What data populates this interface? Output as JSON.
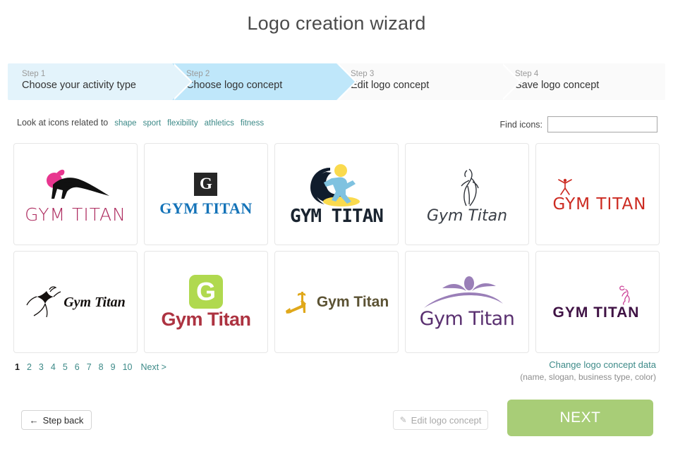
{
  "header": {
    "title": "Logo creation wizard"
  },
  "stepper": {
    "steps": [
      {
        "num": "Step 1",
        "label": "Choose your activity type",
        "state": "done"
      },
      {
        "num": "Step 2",
        "label": "Choose logo concept",
        "state": "active"
      },
      {
        "num": "Step 3",
        "label": "Edit logo concept",
        "state": "pending"
      },
      {
        "num": "Step 4",
        "label": "Save logo concept",
        "state": "pending"
      }
    ]
  },
  "filters": {
    "prefix": "Look at icons related to",
    "tags": [
      "shape",
      "sport",
      "flexibility",
      "athletics",
      "fitness"
    ],
    "tag_color": "#3d8a88"
  },
  "search": {
    "label": "Find icons:",
    "value": "",
    "placeholder": ""
  },
  "logos": [
    {
      "text": "GYM TITAN",
      "icon": "stretching-woman-icon",
      "text_color": "#ad2a5e",
      "accent": "#e8368f"
    },
    {
      "text": "GYM TITAN",
      "icon": "letter-g-dark-square-icon",
      "text_color": "#1473b8",
      "accent": "#262626"
    },
    {
      "text": "GYM TITAN",
      "icon": "runner-moon-sun-icon",
      "text_color": "#1a2430",
      "accent": "#7fc2e0"
    },
    {
      "text": "Gym Titan",
      "icon": "line-dancer-icon",
      "text_color": "#3a3f47",
      "accent": "#3a3f47"
    },
    {
      "text": "GYM TITAN",
      "icon": "red-stick-figure-icon",
      "text_color": "#cc2a21",
      "accent": "#cc2a21"
    },
    {
      "text": "Gym Titan",
      "icon": "star-figure-icon",
      "text_color": "#15110f",
      "accent": "#15110f"
    },
    {
      "text": "Gym Titan",
      "icon": "letter-g-green-square-icon",
      "text_color": "#ad3341",
      "accent": "#b0d94f"
    },
    {
      "text": "Gym Titan",
      "icon": "gold-bench-figure-icon",
      "text_color": "#5b5233",
      "accent": "#e0a81b"
    },
    {
      "text": "Gym Titan",
      "icon": "purple-arc-figure-icon",
      "text_color": "#5a3070",
      "accent": "#9a7fb8"
    },
    {
      "text": "GYM TITAN",
      "icon": "pink-dancer-icon",
      "text_color": "#3f1244",
      "accent": "#cc4499"
    }
  ],
  "pagination": {
    "pages": [
      "1",
      "2",
      "3",
      "4",
      "5",
      "6",
      "7",
      "8",
      "9",
      "10"
    ],
    "current": "1",
    "next_label": "Next >"
  },
  "change_concept": {
    "link": "Change logo concept data",
    "sub": "(name, slogan, business type, color)"
  },
  "footer": {
    "step_back": "Step back",
    "step_back_arrow": "←",
    "edit_logo": "Edit logo concept",
    "edit_icon": "✎",
    "next": "NEXT",
    "next_color": "#a8cd77"
  }
}
